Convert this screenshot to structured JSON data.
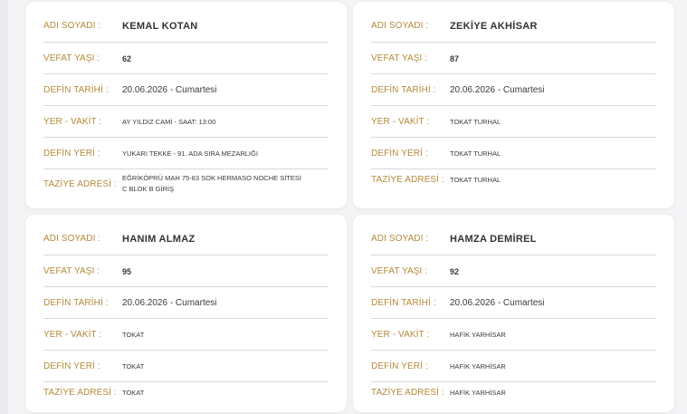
{
  "labels": {
    "name": "ADI SOYADI :",
    "age": "VEFAT YAŞI :",
    "date": "DEFİN TARİHİ :",
    "place_time": "YER - VAKİT :",
    "burial_place": "DEFİN YERİ :",
    "condolence": "TAZİYE ADRESİ :"
  },
  "cards": [
    {
      "name": "KEMAL KOTAN",
      "age": "62",
      "date": "20.06.2026 - Cumartesi",
      "place_time": "AY YILDIZ CAMİ - SAAT: 13:00",
      "burial_place": "YUKARI TEKKE - 91. ADA SIRA MEZARLIĞI",
      "condolence": "EĞRİKÖPRÜ MAH 75-83 SOK HERMASO NOCHE SİTESİ C BLOK B GİRİŞ"
    },
    {
      "name": "ZEKİYE AKHİSAR",
      "age": "87",
      "date": "20.06.2026 - Cumartesi",
      "place_time": "TOKAT TURHAL",
      "burial_place": "TOKAT TURHAL",
      "condolence": "TOKAT TURHAL"
    },
    {
      "name": "HANIM ALMAZ",
      "age": "95",
      "date": "20.06.2026 - Cumartesi",
      "place_time": "TOKAT",
      "burial_place": "TOKAT",
      "condolence": "TOKAT"
    },
    {
      "name": "HAMZA DEMİREL",
      "age": "92",
      "date": "20.06.2026 - Cumartesi",
      "place_time": "HAFİK YARHİSAR",
      "burial_place": "HAFİK YARHİSAR",
      "condolence": "HAFİK YARHİSAR"
    }
  ],
  "colors": {
    "label": "#b48a3a",
    "value": "#3a3a3a",
    "divider": "#d9d9d9",
    "card_bg": "#ffffff",
    "page_bg": "#f4f4f6"
  }
}
